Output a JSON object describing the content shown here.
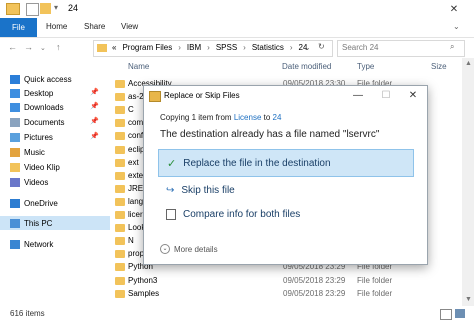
{
  "window": {
    "title": "24",
    "close_glyph": "✕",
    "minimize_glyph": "—",
    "maximize_glyph": "☐"
  },
  "ribbon": {
    "tabs": [
      "File",
      "Home",
      "Share",
      "View"
    ]
  },
  "address": {
    "separator": "«",
    "path": [
      "Program Files",
      "IBM",
      "SPSS",
      "Statistics",
      "24"
    ],
    "search_placeholder": "Search 24"
  },
  "sidebar": {
    "items": [
      {
        "label": "Quick access",
        "icon": "star-icon",
        "pinned": false
      },
      {
        "label": "Desktop",
        "icon": "desktop-icon",
        "pinned": true
      },
      {
        "label": "Downloads",
        "icon": "downloads-icon",
        "pinned": true
      },
      {
        "label": "Documents",
        "icon": "documents-icon",
        "pinned": true
      },
      {
        "label": "Pictures",
        "icon": "pictures-icon",
        "pinned": true
      },
      {
        "label": "Music",
        "icon": "music-icon",
        "pinned": false
      },
      {
        "label": "Video Klip",
        "icon": "folder-icon",
        "pinned": false
      },
      {
        "label": "Videos",
        "icon": "videos-icon",
        "pinned": false
      },
      {
        "label": "OneDrive",
        "icon": "cloud-icon",
        "pinned": false
      },
      {
        "label": "This PC",
        "icon": "computer-icon",
        "pinned": false
      },
      {
        "label": "Network",
        "icon": "network-icon",
        "pinned": false
      }
    ]
  },
  "list": {
    "columns": [
      "Name",
      "Date modified",
      "Type",
      "Size"
    ],
    "rows": [
      {
        "name": "Accessibility",
        "date": "09/05/2018 23:30",
        "type": "File folder"
      },
      {
        "name": "as-2",
        "date": "",
        "type": ""
      },
      {
        "name": "C",
        "date": "",
        "type": ""
      },
      {
        "name": "com",
        "date": "",
        "type": ""
      },
      {
        "name": "conf",
        "date": "",
        "type": ""
      },
      {
        "name": "eclip",
        "date": "",
        "type": ""
      },
      {
        "name": "ext",
        "date": "",
        "type": ""
      },
      {
        "name": "exte",
        "date": "",
        "type": ""
      },
      {
        "name": "JRE",
        "date": "",
        "type": ""
      },
      {
        "name": "lang",
        "date": "",
        "type": ""
      },
      {
        "name": "licer",
        "date": "",
        "type": ""
      },
      {
        "name": "Look",
        "date": "",
        "type": ""
      },
      {
        "name": "N",
        "date": "",
        "type": ""
      },
      {
        "name": "prop",
        "date": "",
        "type": ""
      },
      {
        "name": "Python",
        "date": "09/05/2018 23:29",
        "type": "File folder"
      },
      {
        "name": "Python3",
        "date": "09/05/2018 23:29",
        "type": "File folder"
      },
      {
        "name": "Samples",
        "date": "09/05/2018 23:29",
        "type": "File folder"
      }
    ],
    "status": "616 items"
  },
  "dialog": {
    "title": "Replace or Skip Files",
    "copying_prefix": "Copying 1 item from",
    "copying_from": "License",
    "copying_to_word": "to",
    "copying_to": "24",
    "message": "The destination already has a file named \"lservrc\"",
    "options": [
      {
        "label": "Replace the file in the destination",
        "icon": "check-icon"
      },
      {
        "label": "Skip this file",
        "icon": "skip-icon"
      },
      {
        "label": "Compare info for both files",
        "icon": "compare-icon"
      }
    ],
    "more_details": "More details"
  },
  "colors": {
    "accent": "#1a73c9",
    "folder": "#f2c35a",
    "highlight": "#cfe6f7"
  }
}
